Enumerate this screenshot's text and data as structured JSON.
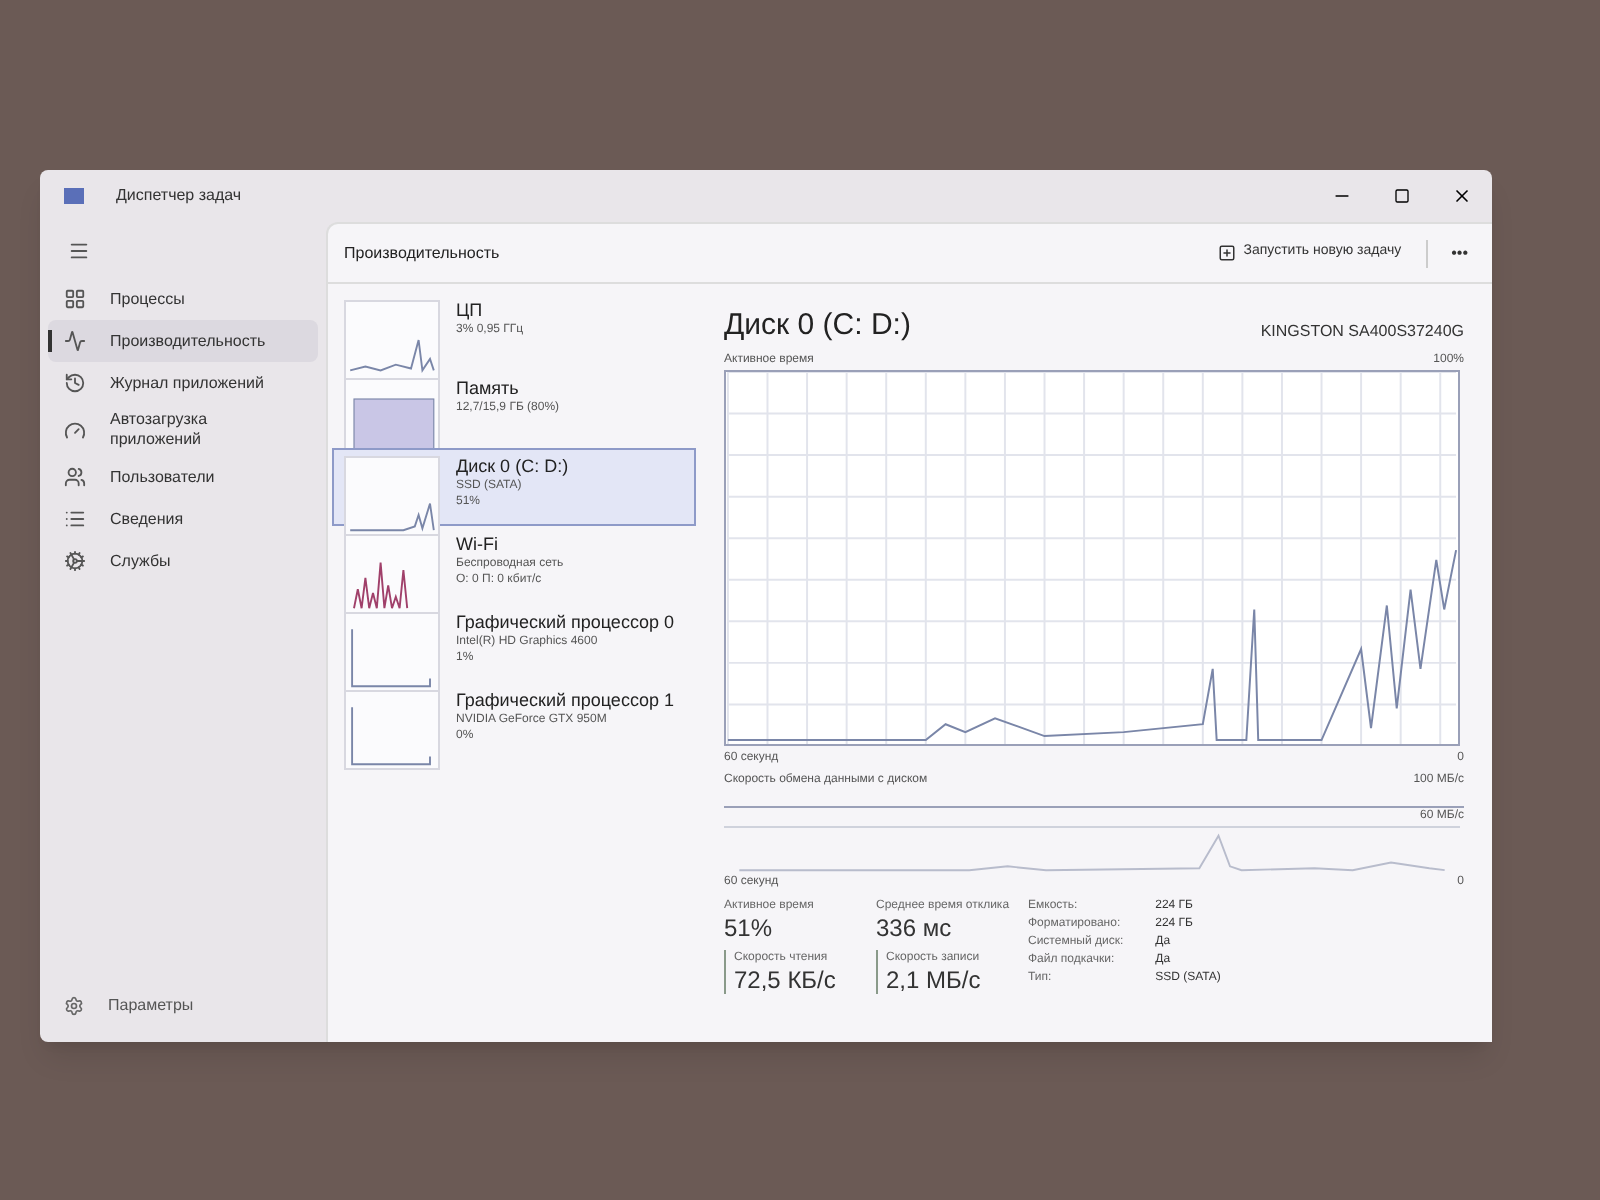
{
  "window": {
    "title": "Диспетчер задач"
  },
  "sidebar": {
    "items": [
      {
        "label": "Процессы",
        "selected": false
      },
      {
        "label": "Производительность",
        "selected": true
      },
      {
        "label": "Журнал приложений",
        "selected": false
      },
      {
        "label": "Автозагрузка приложений",
        "selected": false
      },
      {
        "label": "Пользователи",
        "selected": false
      },
      {
        "label": "Сведения",
        "selected": false
      },
      {
        "label": "Службы",
        "selected": false
      }
    ],
    "settings": "Параметры"
  },
  "header": {
    "title": "Производительность",
    "run_task": "Запустить новую задачу",
    "more": "•••"
  },
  "devices": [
    {
      "name": "ЦП",
      "lines": [
        "3% 0,95 ГГц"
      ],
      "selected": false
    },
    {
      "name": "Память",
      "lines": [
        "12,7/15,9 ГБ (80%)"
      ],
      "selected": false
    },
    {
      "name": "Диск 0 (C: D:)",
      "lines": [
        "SSD (SATA)",
        "51%"
      ],
      "selected": true
    },
    {
      "name": "Wi-Fi",
      "lines": [
        "Беспроводная сеть",
        "О: 0 П: 0 кбит/с"
      ],
      "selected": false
    },
    {
      "name": "Графический процессор 0",
      "lines": [
        "Intel(R) HD Graphics 4600",
        "1%"
      ],
      "selected": false
    },
    {
      "name": "Графический процессор 1",
      "lines": [
        "NVIDIA GeForce GTX 950M",
        "0%"
      ],
      "selected": false
    }
  ],
  "detail": {
    "title": "Диск 0 (C: D:)",
    "model": "KINGSTON SA400S37240G",
    "chart1": {
      "label": "Активное время",
      "max": "100%",
      "time": "60 секунд",
      "min": "0"
    },
    "chart2": {
      "label": "Скорость обмена данными с диском",
      "max": "100 МБ/с",
      "mid": "60 МБ/с",
      "time": "60 секунд",
      "min": "0"
    },
    "stats": [
      {
        "label": "Активное время",
        "value": "51%"
      },
      {
        "label": "Среднее время отклика",
        "value": "336 мс"
      },
      {
        "label": "Скорость чтения",
        "value": "72,5 КБ/с"
      },
      {
        "label": "Скорость записи",
        "value": "2,1 МБ/с"
      }
    ],
    "props": [
      {
        "label": "Емкость:",
        "value": "224 ГБ"
      },
      {
        "label": "Форматировано:",
        "value": "224 ГБ"
      },
      {
        "label": "Системный диск:",
        "value": "Да"
      },
      {
        "label": "Файл подкачки:",
        "value": "Да"
      },
      {
        "label": "Тип:",
        "value": "SSD (SATA)"
      }
    ]
  }
}
